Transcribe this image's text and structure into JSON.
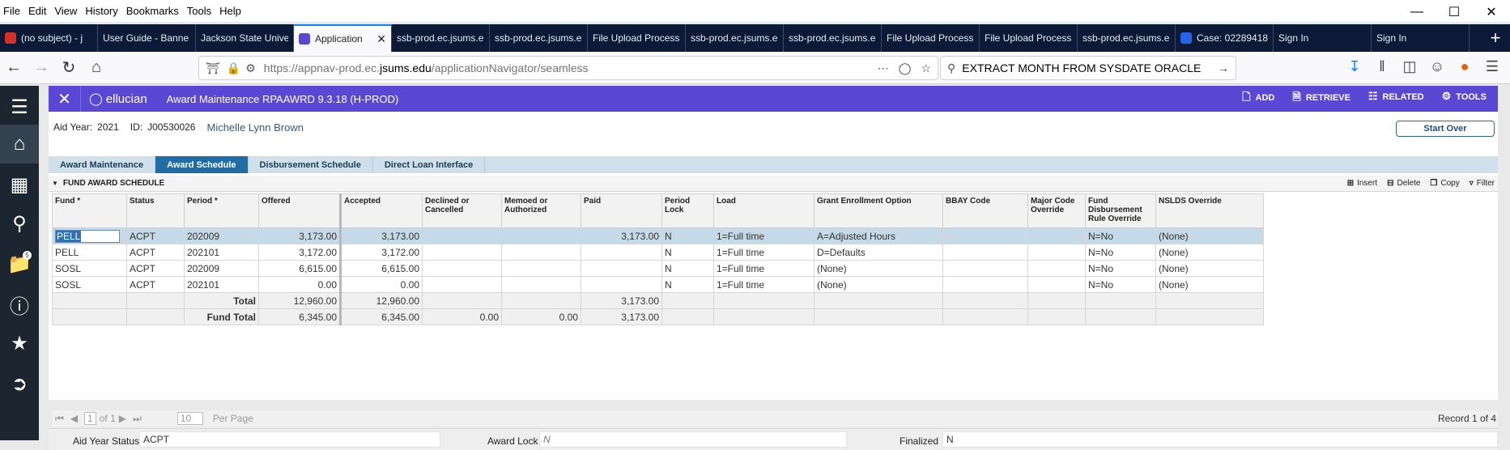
{
  "browser": {
    "menu": [
      "File",
      "Edit",
      "View",
      "History",
      "Bookmarks",
      "Tools",
      "Help"
    ],
    "tabs": [
      {
        "label": "(no subject) - j",
        "fav": "#d93025"
      },
      {
        "label": "User Guide - Banne",
        "fav": ""
      },
      {
        "label": "Jackson State Unive",
        "fav": ""
      },
      {
        "label": "Application",
        "fav": "#5a48d4",
        "active": true
      },
      {
        "label": "ssb-prod.ec.jsums.e",
        "fav": ""
      },
      {
        "label": "ssb-prod.ec.jsums.e",
        "fav": ""
      },
      {
        "label": "File Upload Process",
        "fav": ""
      },
      {
        "label": "ssb-prod.ec.jsums.e",
        "fav": ""
      },
      {
        "label": "ssb-prod.ec.jsums.e",
        "fav": ""
      },
      {
        "label": "File Upload Process",
        "fav": ""
      },
      {
        "label": "File Upload Process",
        "fav": ""
      },
      {
        "label": "ssb-prod.ec.jsums.e",
        "fav": ""
      },
      {
        "label": "Case: 02289418",
        "fav": "#2563eb"
      },
      {
        "label": "Sign In",
        "fav": ""
      },
      {
        "label": "Sign In",
        "fav": ""
      }
    ],
    "url_prefix": "https://appnav-prod.ec.",
    "url_host": "jsums.edu",
    "url_path": "/applicationNavigator/seamless",
    "search_value": "EXTRACT MONTH FROM SYSDATE ORACLE"
  },
  "sidebar": {
    "badge": "5"
  },
  "app": {
    "brand": "ellucian",
    "title": "Award Maintenance RPAAWRD 9.3.18 (H-PROD)",
    "actions": [
      {
        "icon": "add-icon",
        "label": "ADD"
      },
      {
        "icon": "retrieve-icon",
        "label": "RETRIEVE"
      },
      {
        "icon": "related-icon",
        "label": "RELATED"
      },
      {
        "icon": "tools-icon",
        "label": "TOOLS"
      }
    ]
  },
  "key": {
    "aid_year_label": "Aid Year:",
    "aid_year": "2021",
    "id_label": "ID:",
    "id": "J00530026",
    "name": "Michelle Lynn Brown",
    "start_over": "Start Over"
  },
  "subtabs": [
    "Award Maintenance",
    "Award Schedule",
    "Disbursement Schedule",
    "Direct Loan Interface"
  ],
  "section": {
    "title": "FUND AWARD SCHEDULE",
    "actions": [
      "Insert",
      "Delete",
      "Copy",
      "Filter"
    ]
  },
  "grid": {
    "columns": [
      "Fund *",
      "Status",
      "Period *",
      "Offered",
      "Accepted",
      "Declined or Cancelled",
      "Memoed or Authorized",
      "Paid",
      "Period Lock",
      "Load",
      "Grant Enrollment Option",
      "BBAY Code",
      "Major Code Override",
      "Fund Disbursement Rule Override",
      "NSLDS Override"
    ],
    "rows": [
      [
        "PELL",
        "ACPT",
        "202009",
        "3,173.00",
        "3,173.00",
        "",
        "",
        "3,173.00",
        "N",
        "1=Full time",
        "A=Adjusted Hours",
        "",
        "",
        "N=No",
        "(None)"
      ],
      [
        "PELL",
        "ACPT",
        "202101",
        "3,172.00",
        "3,172.00",
        "",
        "",
        "",
        "N",
        "1=Full time",
        "D=Defaults",
        "",
        "",
        "N=No",
        "(None)"
      ],
      [
        "SOSL",
        "ACPT",
        "202009",
        "6,615.00",
        "6,615.00",
        "",
        "",
        "",
        "N",
        "1=Full time",
        "(None)",
        "",
        "",
        "N=No",
        "(None)"
      ],
      [
        "SOSL",
        "ACPT",
        "202101",
        "0.00",
        "0.00",
        "",
        "",
        "",
        "N",
        "1=Full time",
        "(None)",
        "",
        "",
        "N=No",
        "(None)"
      ]
    ],
    "totals": [
      {
        "label": "Total",
        "offered": "12,960.00",
        "accepted": "12,960.00",
        "declined": "",
        "memoed": "",
        "paid": "3,173.00"
      },
      {
        "label": "Fund Total",
        "offered": "6,345.00",
        "accepted": "6,345.00",
        "declined": "0.00",
        "memoed": "0.00",
        "paid": "3,173.00"
      }
    ]
  },
  "pager": {
    "page": "1",
    "of": "of 1",
    "per_page_value": "10",
    "per_page_label": "Per Page",
    "record": "Record 1 of 4"
  },
  "status": {
    "aid_year_status_label": "Aid Year Status",
    "aid_year_status": "ACPT",
    "award_lock_label": "Award Lock",
    "award_lock": "N",
    "finalized_label": "Finalized",
    "finalized": "N"
  }
}
